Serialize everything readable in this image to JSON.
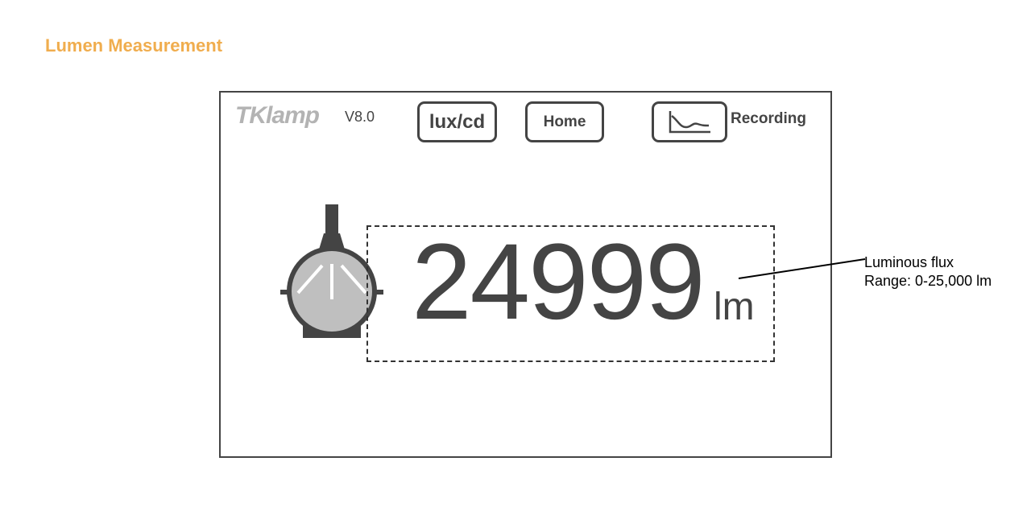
{
  "header": {
    "title": "Lumen Measurement"
  },
  "device": {
    "logo": "TKlamp",
    "version": "V8.0",
    "buttons": {
      "lux_cd": "lux/cd",
      "home": "Home",
      "recording": "Recording"
    },
    "reading": {
      "value": "24999",
      "unit": "lm"
    }
  },
  "annotation": {
    "line1": "Luminous flux",
    "line2": "Range: 0-25,000 lm"
  },
  "icons": {
    "sensor": "integrating-sphere-icon",
    "recording": "line-chart-icon"
  },
  "colors": {
    "title": "#f0ad4e",
    "device_dark": "#444444",
    "logo_gray": "#b3b3b3",
    "sphere_fill": "#bfbfbf"
  }
}
